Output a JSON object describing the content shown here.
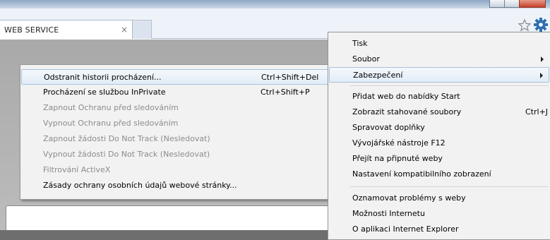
{
  "tab": {
    "title": "WEB SERVICE",
    "close_glyph": "×"
  },
  "toolbar_icons": [
    "favorites-star-icon",
    "tools-gear-icon"
  ],
  "colors": {
    "gear": "#2f6fb1",
    "menu_bg": "#f2f2f2",
    "highlight_border": "#a8c2df",
    "disabled_text": "#8c8c8c"
  },
  "main_menu": {
    "items": [
      {
        "label": "Tisk",
        "shortcut": ""
      },
      {
        "label": "Soubor",
        "shortcut": "",
        "submenu": true
      },
      {
        "label": "Zabezpečení",
        "shortcut": "",
        "submenu": true,
        "highlighted": true
      },
      {
        "label": "Přidat web do nabídky Start",
        "shortcut": ""
      },
      {
        "label": "Zobrazit stahované soubory",
        "shortcut": "Ctrl+J"
      },
      {
        "label": "Spravovat doplňky",
        "shortcut": ""
      },
      {
        "label": "Vývojářské nástroje F12",
        "shortcut": ""
      },
      {
        "label": "Přejít na připnuté weby",
        "shortcut": ""
      },
      {
        "label": "Nastavení kompatibilního zobrazení",
        "shortcut": ""
      },
      {
        "label": "Oznamovat problémy s weby",
        "shortcut": ""
      },
      {
        "label": "Možnosti Internetu",
        "shortcut": ""
      },
      {
        "label": "O aplikaci Internet Explorer",
        "shortcut": ""
      }
    ]
  },
  "security_submenu": {
    "items": [
      {
        "label": "Odstranit historii procházení...",
        "shortcut": "Ctrl+Shift+Del",
        "highlighted": true,
        "enabled": true
      },
      {
        "label": "Procházení se službou InPrivate",
        "shortcut": "Ctrl+Shift+P",
        "enabled": true
      },
      {
        "label": "Zapnout Ochranu před sledováním",
        "shortcut": "",
        "enabled": false
      },
      {
        "label": "Vypnout Ochranu před sledováním",
        "shortcut": "",
        "enabled": false
      },
      {
        "label": "Zapnout žádosti Do Not Track (Nesledovat)",
        "shortcut": "",
        "enabled": false
      },
      {
        "label": "Vypnout žádosti Do Not Track (Nesledovat)",
        "shortcut": "",
        "enabled": false
      },
      {
        "label": "Filtrování ActiveX",
        "shortcut": "",
        "enabled": false
      },
      {
        "label": "Zásady ochrany osobních údajů webové stránky...",
        "shortcut": "",
        "enabled": true
      }
    ]
  }
}
